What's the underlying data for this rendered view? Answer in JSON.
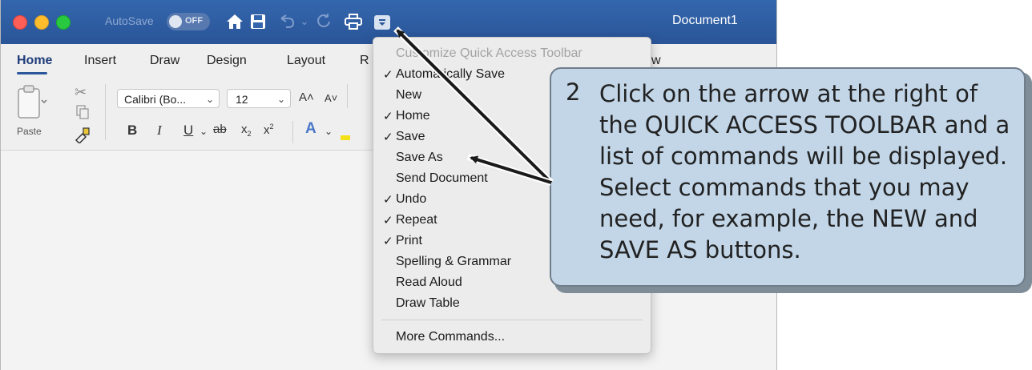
{
  "titlebar": {
    "autosave_label": "AutoSave",
    "autosave_state": "OFF",
    "document_title": "Document1",
    "icons": [
      "home-icon",
      "save-icon",
      "undo-icon",
      "redo-icon",
      "print-icon",
      "customize-dropdown-icon"
    ]
  },
  "ribbon": {
    "tabs": [
      "Home",
      "Insert",
      "Draw",
      "Design",
      "Layout",
      "R",
      "w"
    ],
    "active_tab": "Home",
    "paste_label": "Paste",
    "font_name": "Calibri (Bo...",
    "font_size": "12"
  },
  "menu": {
    "header": "Customize Quick Access Toolbar",
    "items": [
      {
        "label": "Automatically Save",
        "checked": "✓"
      },
      {
        "label": "New",
        "checked": ""
      },
      {
        "label": "Home",
        "checked": "✓"
      },
      {
        "label": "Save",
        "checked": "✓"
      },
      {
        "label": "Save As",
        "checked": ""
      },
      {
        "label": "Send Document",
        "checked": ""
      },
      {
        "label": "Undo",
        "checked": "✓"
      },
      {
        "label": "Repeat",
        "checked": "✓"
      },
      {
        "label": "Print",
        "checked": "✓"
      },
      {
        "label": "Spelling & Grammar",
        "checked": ""
      },
      {
        "label": "Read Aloud",
        "checked": ""
      },
      {
        "label": "Draw Table",
        "checked": ""
      }
    ],
    "more_commands": "More Commands..."
  },
  "callout": {
    "step_number": "2",
    "lines": [
      "Click on the arrow at the right of",
      "the QUICK ACCESS TOOLBAR and a",
      "list of commands will be displayed.",
      "Select commands that you may",
      "need, for example, the NEW and",
      "SAVE AS buttons."
    ]
  },
  "colors": {
    "titlebar": "#2b5797",
    "callout_fill": "#c2d6e8",
    "menu_bg": "#ececec"
  }
}
